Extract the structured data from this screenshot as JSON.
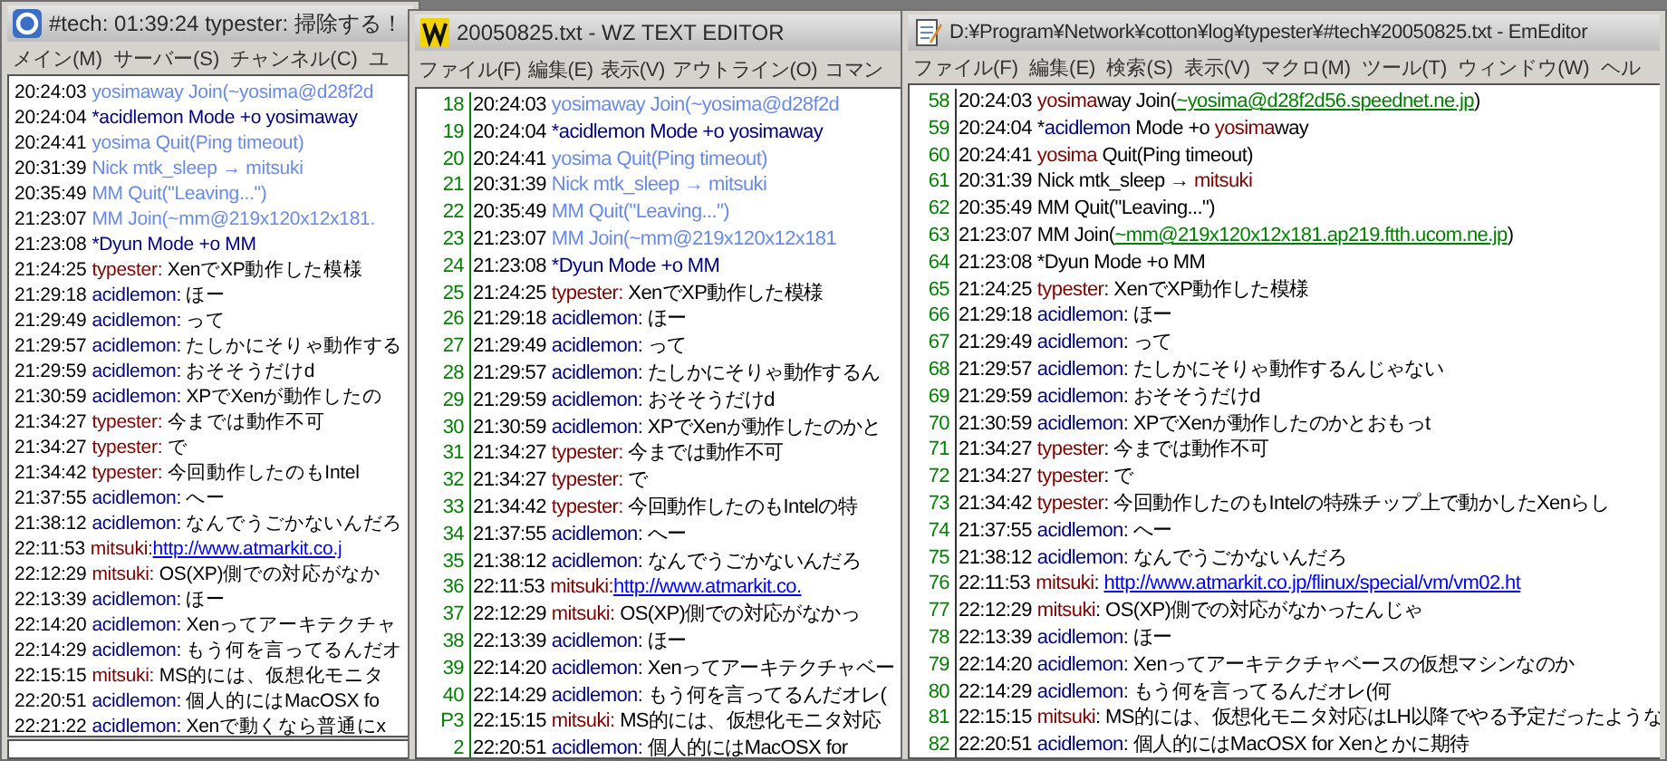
{
  "windows": [
    {
      "kind": "chat",
      "title": "#tech: 01:39:24 typester: 掃除する！",
      "menu": [
        "メイン(M)",
        "サーバー(S)",
        "チャンネル(C)",
        "ユ"
      ],
      "lines": [
        {
          "time": "20:24:03",
          "parts": [
            {
              "kind": "text",
              "color": "#6a8ae8",
              "text": "yosimaway Join(~yosima@d28f2d"
            }
          ]
        },
        {
          "time": "20:24:04",
          "parts": [
            {
              "kind": "text",
              "color": "#000080",
              "text": "*acidlemon Mode +o yosimaway"
            }
          ]
        },
        {
          "time": "20:24:41",
          "parts": [
            {
              "kind": "text",
              "color": "#6a8ae8",
              "text": "yosima Quit(Ping timeout)"
            }
          ]
        },
        {
          "time": "20:31:39",
          "parts": [
            {
              "kind": "text",
              "color": "#6a8ae8",
              "text": "Nick mtk_sleep → mitsuki"
            }
          ]
        },
        {
          "time": "20:35:49",
          "parts": [
            {
              "kind": "text",
              "color": "#6a8ae8",
              "text": "MM Quit(\"Leaving...\")"
            }
          ]
        },
        {
          "time": "21:23:07",
          "parts": [
            {
              "kind": "text",
              "color": "#6a8ae8",
              "text": "MM Join(~mm@219x120x12x181."
            }
          ]
        },
        {
          "time": "21:23:08",
          "parts": [
            {
              "kind": "text",
              "color": "#000080",
              "text": "*Dyun Mode +o MM"
            }
          ]
        },
        {
          "time": "21:24:25",
          "parts": [
            {
              "kind": "nick",
              "color": "#800000",
              "text": "typester:"
            },
            {
              "kind": "text",
              "color": "#000000",
              "text": " XenでXP動作した模様"
            }
          ]
        },
        {
          "time": "21:29:18",
          "parts": [
            {
              "kind": "nick",
              "color": "#000080",
              "text": "acidlemon:"
            },
            {
              "kind": "text",
              "color": "#000000",
              "text": " ほー"
            }
          ]
        },
        {
          "time": "21:29:49",
          "parts": [
            {
              "kind": "nick",
              "color": "#000080",
              "text": "acidlemon:"
            },
            {
              "kind": "text",
              "color": "#000000",
              "text": " って"
            }
          ]
        },
        {
          "time": "21:29:57",
          "parts": [
            {
              "kind": "nick",
              "color": "#000080",
              "text": "acidlemon:"
            },
            {
              "kind": "text",
              "color": "#000000",
              "text": " たしかにそりゃ動作する"
            }
          ]
        },
        {
          "time": "21:29:59",
          "parts": [
            {
              "kind": "nick",
              "color": "#000080",
              "text": "acidlemon:"
            },
            {
              "kind": "text",
              "color": "#000000",
              "text": " おそそうだけd"
            }
          ]
        },
        {
          "time": "21:30:59",
          "parts": [
            {
              "kind": "nick",
              "color": "#000080",
              "text": "acidlemon:"
            },
            {
              "kind": "text",
              "color": "#000000",
              "text": " XPでXenが動作したの"
            }
          ]
        },
        {
          "time": "21:34:27",
          "parts": [
            {
              "kind": "nick",
              "color": "#800000",
              "text": "typester:"
            },
            {
              "kind": "text",
              "color": "#000000",
              "text": " 今までは動作不可"
            }
          ]
        },
        {
          "time": "21:34:27",
          "parts": [
            {
              "kind": "nick",
              "color": "#800000",
              "text": "typester:"
            },
            {
              "kind": "text",
              "color": "#000000",
              "text": " で"
            }
          ]
        },
        {
          "time": "21:34:42",
          "parts": [
            {
              "kind": "nick",
              "color": "#800000",
              "text": "typester:"
            },
            {
              "kind": "text",
              "color": "#000000",
              "text": " 今回動作したのもIntel"
            }
          ]
        },
        {
          "time": "21:37:55",
          "parts": [
            {
              "kind": "nick",
              "color": "#000080",
              "text": "acidlemon:"
            },
            {
              "kind": "text",
              "color": "#000000",
              "text": " へー"
            }
          ]
        },
        {
          "time": "21:38:12",
          "parts": [
            {
              "kind": "nick",
              "color": "#000080",
              "text": "acidlemon:"
            },
            {
              "kind": "text",
              "color": "#000000",
              "text": " なんでうごかないんだろ"
            }
          ]
        },
        {
          "time": "22:11:53",
          "parts": [
            {
              "kind": "nick",
              "color": "#800000",
              "text": "mitsuki:"
            },
            {
              "kind": "link",
              "color": "#0000ff",
              "text": "http://www.atmarkit.co.j"
            }
          ]
        },
        {
          "time": "22:12:29",
          "parts": [
            {
              "kind": "nick",
              "color": "#800000",
              "text": "mitsuki:"
            },
            {
              "kind": "text",
              "color": "#000000",
              "text": " OS(XP)側での対応がなか"
            }
          ]
        },
        {
          "time": "22:13:39",
          "parts": [
            {
              "kind": "nick",
              "color": "#000080",
              "text": "acidlemon:"
            },
            {
              "kind": "text",
              "color": "#000000",
              "text": " ほー"
            }
          ]
        },
        {
          "time": "22:14:20",
          "parts": [
            {
              "kind": "nick",
              "color": "#000080",
              "text": "acidlemon:"
            },
            {
              "kind": "text",
              "color": "#000000",
              "text": " Xenってアーキテクチャ"
            }
          ]
        },
        {
          "time": "22:14:29",
          "parts": [
            {
              "kind": "nick",
              "color": "#000080",
              "text": "acidlemon:"
            },
            {
              "kind": "text",
              "color": "#000000",
              "text": " もう何を言ってるんだオ"
            }
          ]
        },
        {
          "time": "22:15:15",
          "parts": [
            {
              "kind": "nick",
              "color": "#800000",
              "text": "mitsuki:"
            },
            {
              "kind": "text",
              "color": "#000000",
              "text": " MS的には、仮想化モニタ"
            }
          ]
        },
        {
          "time": "22:20:51",
          "parts": [
            {
              "kind": "nick",
              "color": "#000080",
              "text": "acidlemon:"
            },
            {
              "kind": "text",
              "color": "#000000",
              "text": " 個人的にはMacOSX fo"
            }
          ]
        },
        {
          "time": "22:21:22",
          "parts": [
            {
              "kind": "nick",
              "color": "#000080",
              "text": "acidlemon:"
            },
            {
              "kind": "text",
              "color": "#000000",
              "text": " Xenで動くなら普通にx"
            }
          ]
        }
      ]
    },
    {
      "kind": "editor",
      "title": "20050825.txt - WZ TEXT EDITOR",
      "menu": [
        "ファイル(F)",
        "編集(E)",
        "表示(V)",
        "アウトライン(O)",
        "コマン"
      ],
      "lines": [
        {
          "number": "18",
          "time": "20:24:03",
          "parts": [
            {
              "kind": "text",
              "color": "#6a8ae8",
              "text": "yosimaway Join(~yosima@d28f2d"
            }
          ]
        },
        {
          "number": "19",
          "time": "20:24:04",
          "parts": [
            {
              "kind": "text",
              "color": "#000080",
              "text": "*acidlemon Mode +o yosimaway"
            }
          ]
        },
        {
          "number": "20",
          "time": "20:24:41",
          "parts": [
            {
              "kind": "text",
              "color": "#6a8ae8",
              "text": "yosima Quit(Ping timeout)"
            }
          ]
        },
        {
          "number": "21",
          "time": "20:31:39",
          "parts": [
            {
              "kind": "text",
              "color": "#6a8ae8",
              "text": "Nick mtk_sleep → mitsuki"
            }
          ]
        },
        {
          "number": "22",
          "time": "20:35:49",
          "parts": [
            {
              "kind": "text",
              "color": "#6a8ae8",
              "text": "MM Quit(\"Leaving...\")"
            }
          ]
        },
        {
          "number": "23",
          "time": "21:23:07",
          "parts": [
            {
              "kind": "text",
              "color": "#6a8ae8",
              "text": "MM Join(~mm@219x120x12x181"
            }
          ]
        },
        {
          "number": "24",
          "time": "21:23:08",
          "parts": [
            {
              "kind": "text",
              "color": "#000080",
              "text": "*Dyun Mode +o MM"
            }
          ]
        },
        {
          "number": "25",
          "time": "21:24:25",
          "parts": [
            {
              "kind": "nick",
              "color": "#800000",
              "text": "typester:"
            },
            {
              "kind": "text",
              "color": "#000000",
              "text": " XenでXP動作した模様"
            }
          ]
        },
        {
          "number": "26",
          "time": "21:29:18",
          "parts": [
            {
              "kind": "nick",
              "color": "#000080",
              "text": "acidlemon:"
            },
            {
              "kind": "text",
              "color": "#000000",
              "text": " ほー"
            }
          ]
        },
        {
          "number": "27",
          "time": "21:29:49",
          "parts": [
            {
              "kind": "nick",
              "color": "#000080",
              "text": "acidlemon:"
            },
            {
              "kind": "text",
              "color": "#000000",
              "text": " って"
            }
          ]
        },
        {
          "number": "28",
          "time": "21:29:57",
          "parts": [
            {
              "kind": "nick",
              "color": "#000080",
              "text": "acidlemon:"
            },
            {
              "kind": "text",
              "color": "#000000",
              "text": " たしかにそりゃ動作するん"
            }
          ]
        },
        {
          "number": "29",
          "time": "21:29:59",
          "parts": [
            {
              "kind": "nick",
              "color": "#000080",
              "text": "acidlemon:"
            },
            {
              "kind": "text",
              "color": "#000000",
              "text": " おそそうだけd"
            }
          ]
        },
        {
          "number": "30",
          "time": "21:30:59",
          "parts": [
            {
              "kind": "nick",
              "color": "#000080",
              "text": "acidlemon:"
            },
            {
              "kind": "text",
              "color": "#000000",
              "text": " XPでXenが動作したのかと"
            }
          ]
        },
        {
          "number": "31",
          "time": "21:34:27",
          "parts": [
            {
              "kind": "nick",
              "color": "#800000",
              "text": "typester:"
            },
            {
              "kind": "text",
              "color": "#000000",
              "text": " 今までは動作不可"
            }
          ]
        },
        {
          "number": "32",
          "time": "21:34:27",
          "parts": [
            {
              "kind": "nick",
              "color": "#800000",
              "text": "typester:"
            },
            {
              "kind": "text",
              "color": "#000000",
              "text": " で"
            }
          ]
        },
        {
          "number": "33",
          "time": "21:34:42",
          "parts": [
            {
              "kind": "nick",
              "color": "#800000",
              "text": "typester:"
            },
            {
              "kind": "text",
              "color": "#000000",
              "text": " 今回動作したのもIntelの特"
            }
          ]
        },
        {
          "number": "34",
          "time": "21:37:55",
          "parts": [
            {
              "kind": "nick",
              "color": "#000080",
              "text": "acidlemon:"
            },
            {
              "kind": "text",
              "color": "#000000",
              "text": " へー"
            }
          ]
        },
        {
          "number": "35",
          "time": "21:38:12",
          "parts": [
            {
              "kind": "nick",
              "color": "#000080",
              "text": "acidlemon:"
            },
            {
              "kind": "text",
              "color": "#000000",
              "text": " なんでうごかないんだろ"
            }
          ]
        },
        {
          "number": "36",
          "time": "22:11:53",
          "parts": [
            {
              "kind": "nick",
              "color": "#800000",
              "text": "mitsuki:"
            },
            {
              "kind": "link",
              "color": "#0000ff",
              "text": "http://www.atmarkit.co."
            }
          ]
        },
        {
          "number": "37",
          "time": "22:12:29",
          "parts": [
            {
              "kind": "nick",
              "color": "#800000",
              "text": "mitsuki:"
            },
            {
              "kind": "text",
              "color": "#000000",
              "text": " OS(XP)側での対応がなかっ"
            }
          ]
        },
        {
          "number": "38",
          "time": "22:13:39",
          "parts": [
            {
              "kind": "nick",
              "color": "#000080",
              "text": "acidlemon:"
            },
            {
              "kind": "text",
              "color": "#000000",
              "text": " ほー"
            }
          ]
        },
        {
          "number": "39",
          "time": "22:14:20",
          "parts": [
            {
              "kind": "nick",
              "color": "#000080",
              "text": "acidlemon:"
            },
            {
              "kind": "text",
              "color": "#000000",
              "text": " Xenってアーキテクチャベー"
            }
          ]
        },
        {
          "number": "40",
          "time": "22:14:29",
          "parts": [
            {
              "kind": "nick",
              "color": "#000080",
              "text": "acidlemon:"
            },
            {
              "kind": "text",
              "color": "#000000",
              "text": " もう何を言ってるんだオレ("
            }
          ]
        },
        {
          "number": "P3",
          "time": "22:15:15",
          "parts": [
            {
              "kind": "nick",
              "color": "#800000",
              "text": "mitsuki:"
            },
            {
              "kind": "text",
              "color": "#000000",
              "text": " MS的には、仮想化モニタ対応"
            }
          ]
        },
        {
          "number": "2",
          "time": "22:20:51",
          "parts": [
            {
              "kind": "nick",
              "color": "#000080",
              "text": "acidlemon:"
            },
            {
              "kind": "text",
              "color": "#000000",
              "text": " 個人的にはMacOSX for"
            }
          ]
        }
      ]
    },
    {
      "kind": "editor",
      "title": "D:¥Program¥Network¥cotton¥log¥typester¥#tech¥20050825.txt - EmEditor",
      "menu": [
        "ファイル(F)",
        "編集(E)",
        "検索(S)",
        "表示(V)",
        "マクロ(M)",
        "ツール(T)",
        "ウィンドウ(W)",
        "ヘル"
      ],
      "lines": [
        {
          "number": "58",
          "time": "20:24:03",
          "parts": [
            {
              "kind": "nick",
              "color": "#800000",
              "text": "yosima"
            },
            {
              "kind": "text",
              "color": "#000000",
              "text": "way Join("
            },
            {
              "kind": "link",
              "color": "#008000",
              "text": "~yosima@d28f2d56.speednet.ne.jp"
            },
            {
              "kind": "text",
              "color": "#000000",
              "text": ")"
            }
          ]
        },
        {
          "number": "59",
          "time": "20:24:04",
          "parts": [
            {
              "kind": "text",
              "color": "#000000",
              "text": "*"
            },
            {
              "kind": "nick",
              "color": "#000080",
              "text": "acidlemon"
            },
            {
              "kind": "text",
              "color": "#000000",
              "text": " Mode +o "
            },
            {
              "kind": "nick",
              "color": "#800000",
              "text": "yosima"
            },
            {
              "kind": "text",
              "color": "#000000",
              "text": "way"
            }
          ]
        },
        {
          "number": "60",
          "time": "20:24:41",
          "parts": [
            {
              "kind": "nick",
              "color": "#800000",
              "text": "yosima"
            },
            {
              "kind": "text",
              "color": "#000000",
              "text": " Quit(Ping timeout)"
            }
          ]
        },
        {
          "number": "61",
          "time": "20:31:39",
          "parts": [
            {
              "kind": "text",
              "color": "#000000",
              "text": "Nick mtk_sleep → "
            },
            {
              "kind": "nick",
              "color": "#800000",
              "text": "mitsuki"
            }
          ]
        },
        {
          "number": "62",
          "time": "20:35:49",
          "parts": [
            {
              "kind": "text",
              "color": "#000000",
              "text": "MM Quit(\"Leaving...\")"
            }
          ]
        },
        {
          "number": "63",
          "time": "21:23:07",
          "parts": [
            {
              "kind": "text",
              "color": "#000000",
              "text": "MM Join("
            },
            {
              "kind": "link",
              "color": "#008000",
              "text": "~mm@219x120x12x181.ap219.ftth.ucom.ne.jp"
            },
            {
              "kind": "text",
              "color": "#000000",
              "text": ")"
            }
          ]
        },
        {
          "number": "64",
          "time": "21:23:08",
          "parts": [
            {
              "kind": "text",
              "color": "#000000",
              "text": "*Dyun Mode +o MM"
            }
          ]
        },
        {
          "number": "65",
          "time": "21:24:25",
          "parts": [
            {
              "kind": "nick",
              "color": "#800000",
              "text": "typester"
            },
            {
              "kind": "text",
              "color": "#000000",
              "text": ": XenでXP動作した模様"
            }
          ]
        },
        {
          "number": "66",
          "time": "21:29:18",
          "parts": [
            {
              "kind": "nick",
              "color": "#000080",
              "text": "acidlemon"
            },
            {
              "kind": "text",
              "color": "#000000",
              "text": ": ほー"
            }
          ]
        },
        {
          "number": "67",
          "time": "21:29:49",
          "parts": [
            {
              "kind": "nick",
              "color": "#000080",
              "text": "acidlemon"
            },
            {
              "kind": "text",
              "color": "#000000",
              "text": ": って"
            }
          ]
        },
        {
          "number": "68",
          "time": "21:29:57",
          "parts": [
            {
              "kind": "nick",
              "color": "#000080",
              "text": "acidlemon"
            },
            {
              "kind": "text",
              "color": "#000000",
              "text": ": たしかにそりゃ動作するんじゃない"
            }
          ]
        },
        {
          "number": "69",
          "time": "21:29:59",
          "parts": [
            {
              "kind": "nick",
              "color": "#000080",
              "text": "acidlemon"
            },
            {
              "kind": "text",
              "color": "#000000",
              "text": ": おそそうだけd"
            }
          ]
        },
        {
          "number": "70",
          "time": "21:30:59",
          "parts": [
            {
              "kind": "nick",
              "color": "#000080",
              "text": "acidlemon"
            },
            {
              "kind": "text",
              "color": "#000000",
              "text": ": XPでXenが動作したのかとおもっt"
            }
          ]
        },
        {
          "number": "71",
          "time": "21:34:27",
          "parts": [
            {
              "kind": "nick",
              "color": "#800000",
              "text": "typester"
            },
            {
              "kind": "text",
              "color": "#000000",
              "text": ": 今までは動作不可"
            }
          ]
        },
        {
          "number": "72",
          "time": "21:34:27",
          "parts": [
            {
              "kind": "nick",
              "color": "#800000",
              "text": "typester"
            },
            {
              "kind": "text",
              "color": "#000000",
              "text": ": で"
            }
          ]
        },
        {
          "number": "73",
          "time": "21:34:42",
          "parts": [
            {
              "kind": "nick",
              "color": "#800000",
              "text": "typester"
            },
            {
              "kind": "text",
              "color": "#000000",
              "text": ": 今回動作したのもIntelの特殊チップ上で動かしたXenらし"
            }
          ]
        },
        {
          "number": "74",
          "time": "21:37:55",
          "parts": [
            {
              "kind": "nick",
              "color": "#000080",
              "text": "acidlemon"
            },
            {
              "kind": "text",
              "color": "#000000",
              "text": ": へー"
            }
          ]
        },
        {
          "number": "75",
          "time": "21:38:12",
          "parts": [
            {
              "kind": "nick",
              "color": "#000080",
              "text": "acidlemon"
            },
            {
              "kind": "text",
              "color": "#000000",
              "text": ": なんでうごかないんだろ"
            }
          ]
        },
        {
          "number": "76",
          "time": "22:11:53",
          "parts": [
            {
              "kind": "nick",
              "color": "#800000",
              "text": "mitsuki"
            },
            {
              "kind": "text",
              "color": "#000000",
              "text": ": "
            },
            {
              "kind": "link",
              "color": "#0000ff",
              "text": "http://www.atmarkit.co.jp/flinux/special/vm/vm02.ht"
            }
          ]
        },
        {
          "number": "77",
          "time": "22:12:29",
          "parts": [
            {
              "kind": "nick",
              "color": "#800000",
              "text": "mitsuki"
            },
            {
              "kind": "text",
              "color": "#000000",
              "text": ": OS(XP)側での対応がなかったんじゃ"
            }
          ]
        },
        {
          "number": "78",
          "time": "22:13:39",
          "parts": [
            {
              "kind": "nick",
              "color": "#000080",
              "text": "acidlemon"
            },
            {
              "kind": "text",
              "color": "#000000",
              "text": ": ほー"
            }
          ]
        },
        {
          "number": "79",
          "time": "22:14:20",
          "parts": [
            {
              "kind": "nick",
              "color": "#000080",
              "text": "acidlemon"
            },
            {
              "kind": "text",
              "color": "#000000",
              "text": ": Xenってアーキテクチャベースの仮想マシンなのか"
            }
          ]
        },
        {
          "number": "80",
          "time": "22:14:29",
          "parts": [
            {
              "kind": "nick",
              "color": "#000080",
              "text": "acidlemon"
            },
            {
              "kind": "text",
              "color": "#000000",
              "text": ": もう何を言ってるんだオレ(何"
            }
          ]
        },
        {
          "number": "81",
          "time": "22:15:15",
          "parts": [
            {
              "kind": "nick",
              "color": "#800000",
              "text": "mitsuki"
            },
            {
              "kind": "text",
              "color": "#000000",
              "text": ": MS的には、仮想化モニタ対応はLH以降でやる予定だったような"
            }
          ]
        },
        {
          "number": "82",
          "time": "22:20:51",
          "parts": [
            {
              "kind": "nick",
              "color": "#000080",
              "text": "acidlemon"
            },
            {
              "kind": "text",
              "color": "#000000",
              "text": ": 個人的にはMacOSX for Xenとかに期待"
            }
          ]
        }
      ]
    }
  ]
}
